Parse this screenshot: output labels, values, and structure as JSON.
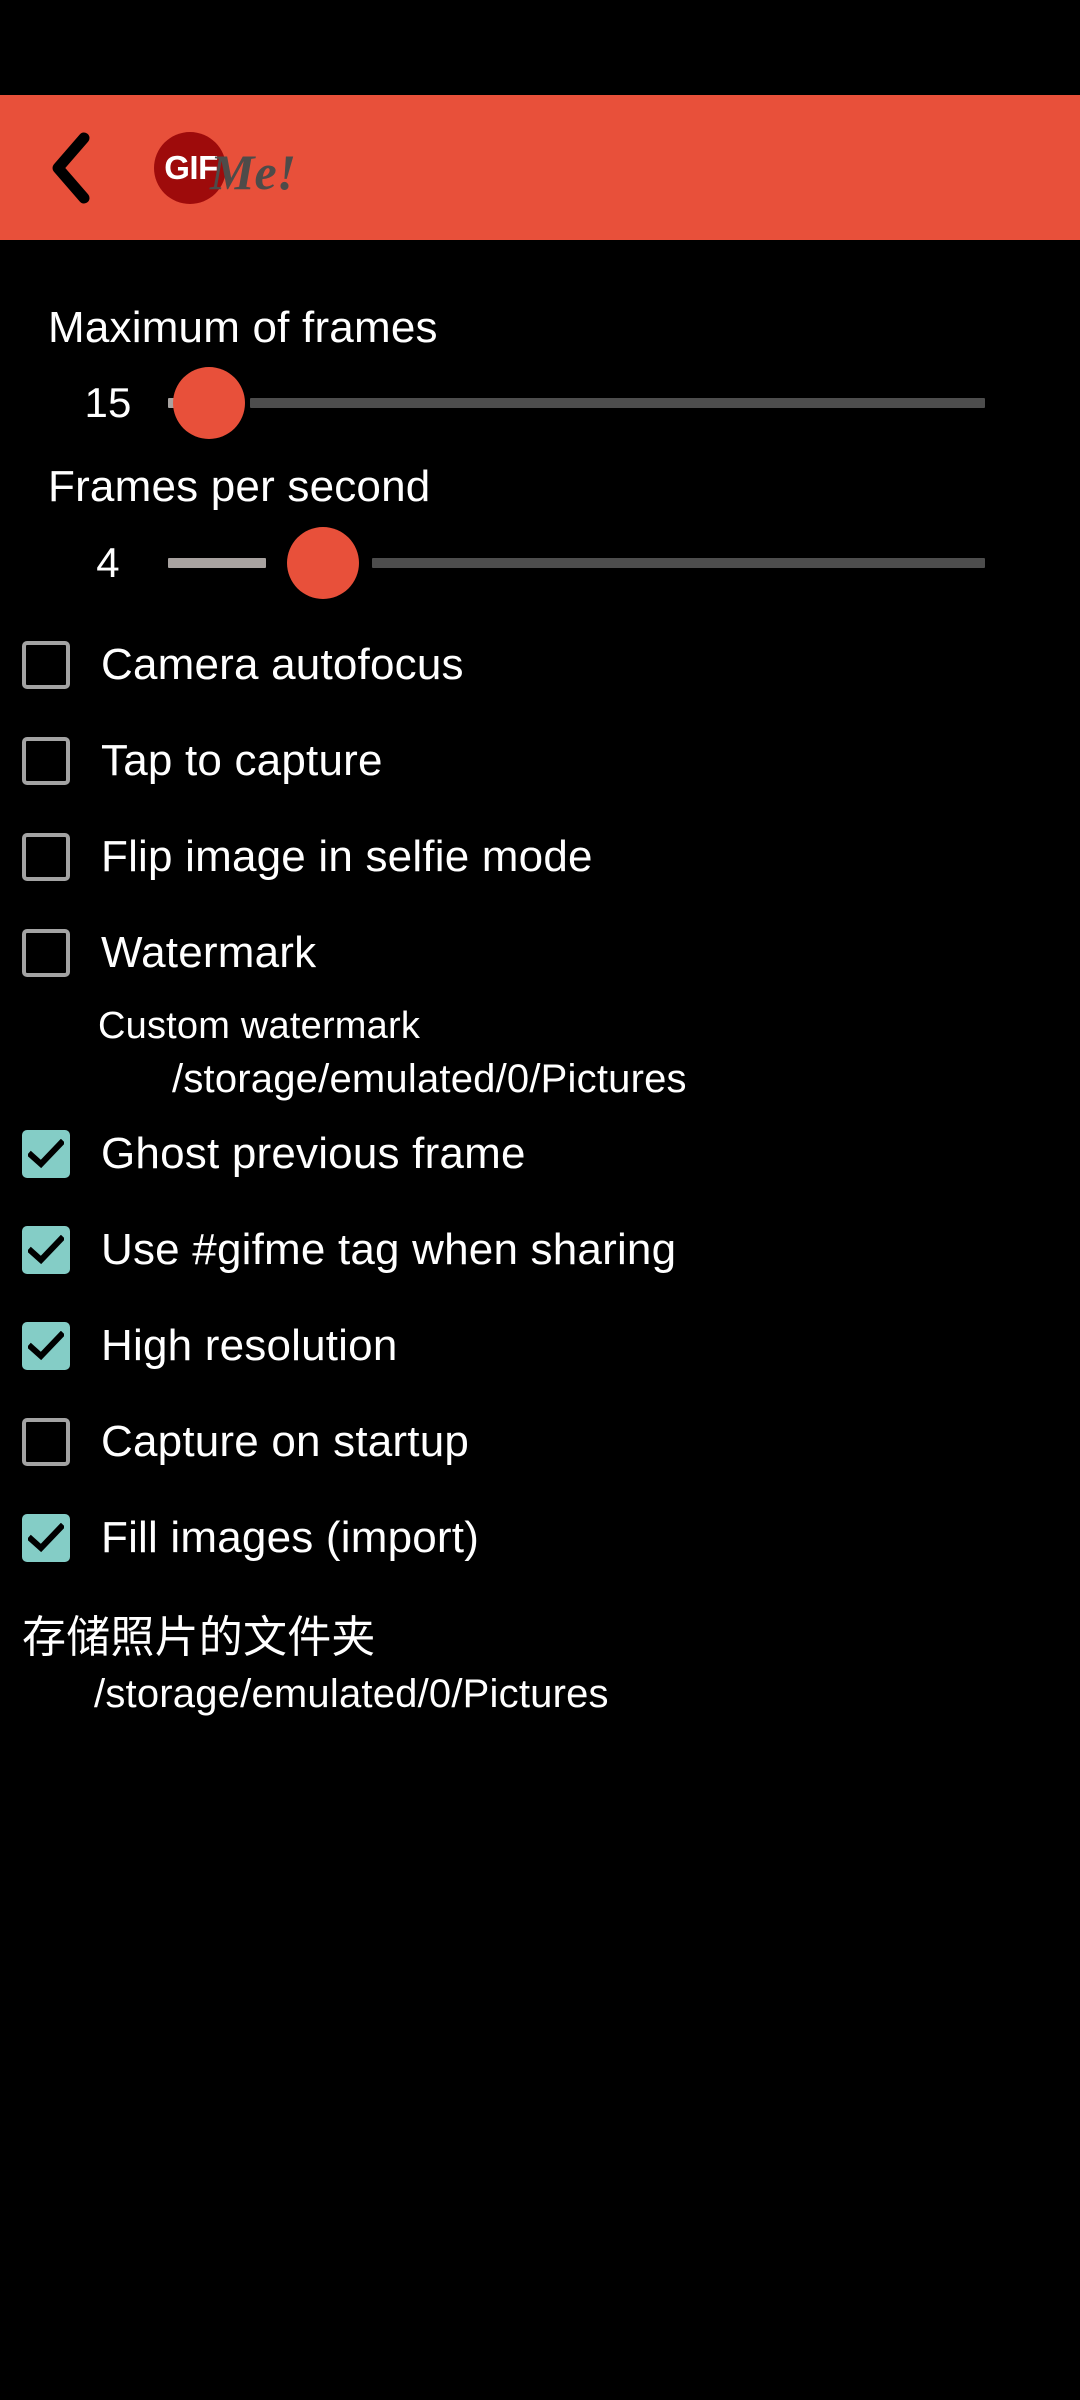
{
  "status_bar": {
    "background": "#000000"
  },
  "app_bar": {
    "background": "#e8503a",
    "back_icon": "chevron-left-icon",
    "logo": {
      "badge_text": "GIF",
      "script_text": "Me!",
      "badge_color": "#9e0b0b",
      "script_color": "#4e4b49"
    }
  },
  "sliders": [
    {
      "label": "Maximum of frames",
      "value": "15",
      "thumb_percent": 5,
      "accent": "#e8503a",
      "track_color": "#4d4d4d",
      "fill_color": "#a8a2a0"
    },
    {
      "label": "Frames per second",
      "value": "4",
      "thumb_percent": 19,
      "accent": "#e8503a",
      "track_color": "#4d4d4d",
      "fill_color": "#a8a2a0"
    }
  ],
  "checkboxes": [
    {
      "label": "Camera autofocus",
      "checked": false
    },
    {
      "label": "Tap to capture",
      "checked": false
    },
    {
      "label": "Flip image in selfie mode",
      "checked": false
    },
    {
      "label": "Watermark",
      "checked": false
    },
    {
      "label": "Ghost previous frame",
      "checked": true
    },
    {
      "label": "Use #gifme tag when sharing",
      "checked": true
    },
    {
      "label": "High resolution",
      "checked": true
    },
    {
      "label": "Capture on startup",
      "checked": false
    },
    {
      "label": "Fill images (import)",
      "checked": true
    }
  ],
  "custom_watermark": {
    "title": "Custom watermark",
    "path": "/storage/emulated/0/Pictures"
  },
  "photo_folder": {
    "title": "存储照片的文件夹",
    "path": "/storage/emulated/0/Pictures"
  },
  "colors": {
    "accent_red": "#e8503a",
    "checked_teal": "#84cdc6",
    "unchecked_gray": "#a3a3a3",
    "background": "#000000"
  }
}
